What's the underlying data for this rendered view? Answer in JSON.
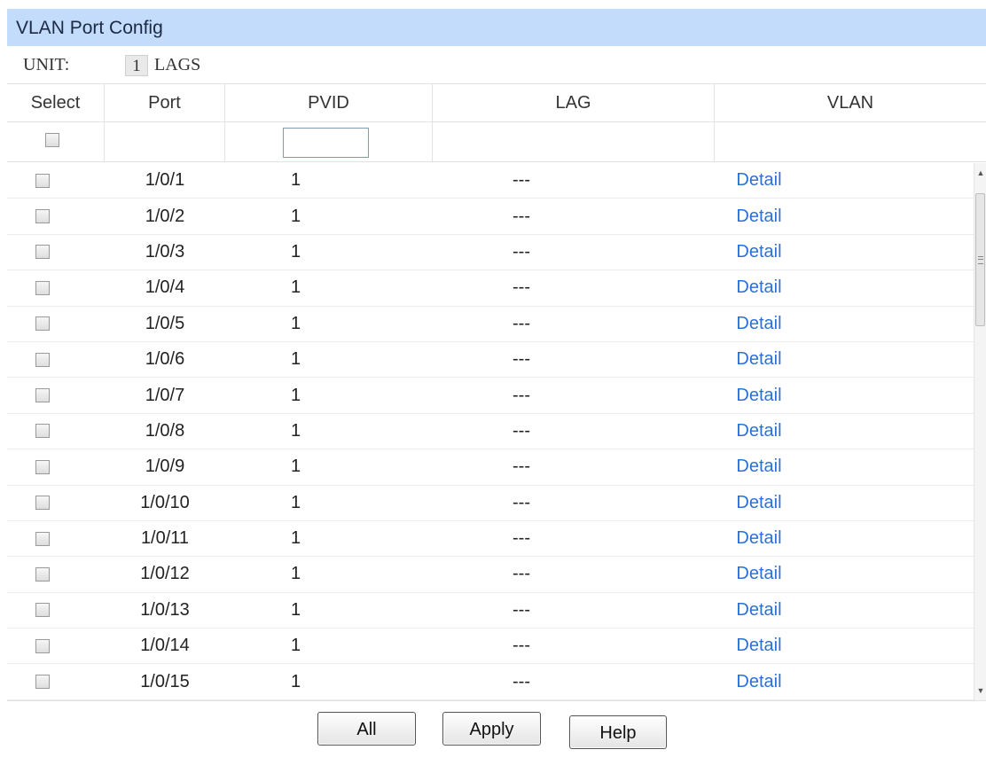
{
  "panel": {
    "title": "VLAN Port Config",
    "unit_label": "UNIT:",
    "unit_value": "1",
    "lags_label": "LAGS"
  },
  "columns": [
    "Select",
    "Port",
    "PVID",
    "LAG",
    "VLAN"
  ],
  "pvid_filter": {
    "value": ""
  },
  "rows": [
    {
      "port": "1/0/1",
      "pvid": "1",
      "lag": "---",
      "vlan": "Detail",
      "selected": false
    },
    {
      "port": "1/0/2",
      "pvid": "1",
      "lag": "---",
      "vlan": "Detail",
      "selected": false
    },
    {
      "port": "1/0/3",
      "pvid": "1",
      "lag": "---",
      "vlan": "Detail",
      "selected": false
    },
    {
      "port": "1/0/4",
      "pvid": "1",
      "lag": "---",
      "vlan": "Detail",
      "selected": false
    },
    {
      "port": "1/0/5",
      "pvid": "1",
      "lag": "---",
      "vlan": "Detail",
      "selected": false
    },
    {
      "port": "1/0/6",
      "pvid": "1",
      "lag": "---",
      "vlan": "Detail",
      "selected": false
    },
    {
      "port": "1/0/7",
      "pvid": "1",
      "lag": "---",
      "vlan": "Detail",
      "selected": false
    },
    {
      "port": "1/0/8",
      "pvid": "1",
      "lag": "---",
      "vlan": "Detail",
      "selected": false
    },
    {
      "port": "1/0/9",
      "pvid": "1",
      "lag": "---",
      "vlan": "Detail",
      "selected": false
    },
    {
      "port": "1/0/10",
      "pvid": "1",
      "lag": "---",
      "vlan": "Detail",
      "selected": false
    },
    {
      "port": "1/0/11",
      "pvid": "1",
      "lag": "---",
      "vlan": "Detail",
      "selected": false
    },
    {
      "port": "1/0/12",
      "pvid": "1",
      "lag": "---",
      "vlan": "Detail",
      "selected": false
    },
    {
      "port": "1/0/13",
      "pvid": "1",
      "lag": "---",
      "vlan": "Detail",
      "selected": false
    },
    {
      "port": "1/0/14",
      "pvid": "1",
      "lag": "---",
      "vlan": "Detail",
      "selected": false
    },
    {
      "port": "1/0/15",
      "pvid": "1",
      "lag": "---",
      "vlan": "Detail",
      "selected": false
    }
  ],
  "buttons": {
    "all": "All",
    "apply": "Apply",
    "help": "Help"
  },
  "colors": {
    "title_bg": "#c4dcfb",
    "link": "#2a70d8"
  }
}
